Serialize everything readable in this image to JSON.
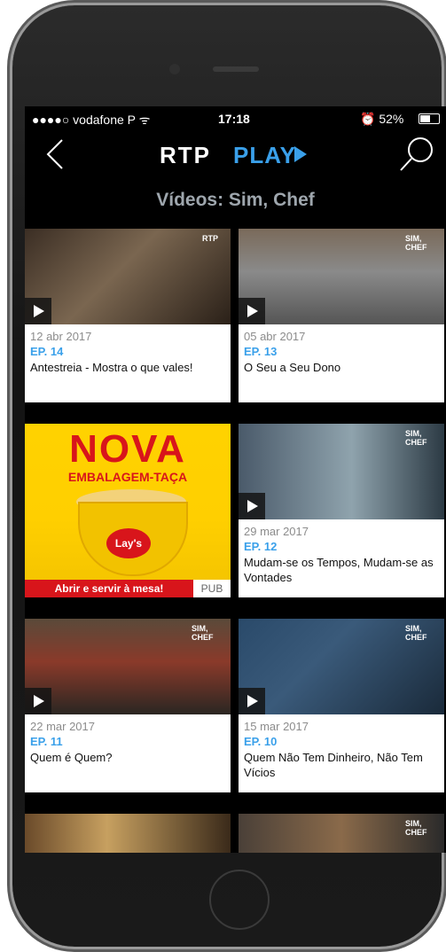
{
  "status_bar": {
    "carrier": "●●●●○ vodafone P ᯤ",
    "time": "17:18",
    "battery": "⏰ 52%"
  },
  "navbar": {
    "logo_rtp": "RTP",
    "logo_play": "PLAY"
  },
  "page_title": "Vídeos: Sim, Chef",
  "cards": [
    {
      "date": "12 abr 2017",
      "episode": "EP. 14",
      "title": "Antestreia - Mostra o que vales!"
    },
    {
      "date": "05 abr 2017",
      "episode": "EP. 13",
      "title": "O Seu a Seu Dono"
    },
    {
      "date": "29 mar 2017",
      "episode": "EP. 12",
      "title": "Mudam-se os Tempos, Mudam-se as Vontades"
    },
    {
      "date": "22 mar 2017",
      "episode": "EP. 11",
      "title": "Quem é Quem?"
    },
    {
      "date": "15 mar 2017",
      "episode": "EP. 10",
      "title": "Quem Não Tem Dinheiro, Não Tem Vícios"
    }
  ],
  "ad": {
    "headline": "NOVA",
    "subheadline": "EMBALAGEM-TAÇA",
    "brand": "Lay's",
    "strip_text": "Abrir e servir à mesa!",
    "badge": "PUB"
  },
  "thumb_tags": {
    "rtp": "RTP",
    "sim_chef": "SIM, CHEF"
  }
}
